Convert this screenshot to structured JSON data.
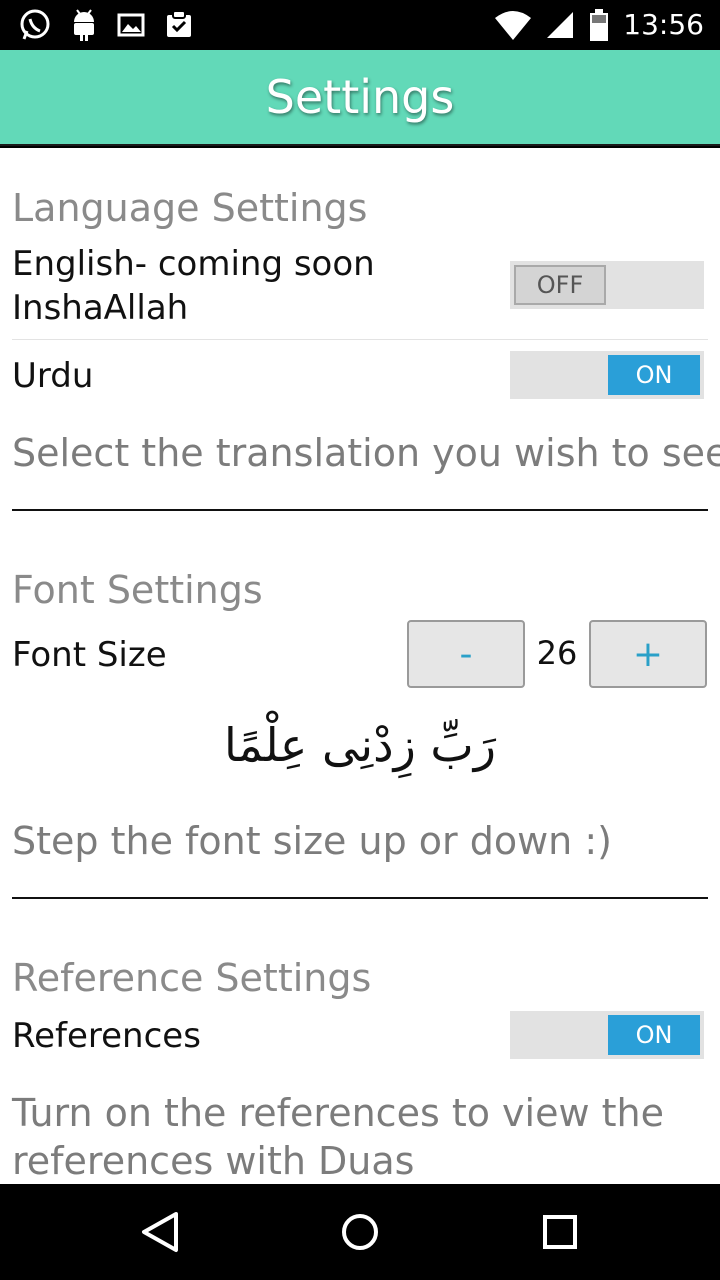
{
  "status_bar": {
    "time": "13:56",
    "left_icons": [
      "whatsapp-icon",
      "android-icon",
      "image-icon",
      "clipboard-icon"
    ],
    "right_icons": [
      "wifi-icon",
      "signal-icon",
      "battery-icon"
    ]
  },
  "app_bar": {
    "title": "Settings",
    "color": "#62d9b8"
  },
  "language": {
    "header": "Language Settings",
    "english_label_line1": "English- coming soon",
    "english_label_line2": "InshaAllah",
    "english_toggle": "OFF",
    "urdu_label": "Urdu",
    "urdu_toggle": "ON",
    "description": "Select the translation you wish to see"
  },
  "font": {
    "header": "Font Settings",
    "label": "Font Size",
    "decrease_label": "-",
    "increase_label": "+",
    "value": "26",
    "sample_text": "رَبِّ زِدْنِى عِلْمًا",
    "description": "Step the font size up or down :)"
  },
  "reference": {
    "header": "Reference Settings",
    "label": "References",
    "toggle": "ON",
    "description_line1": "Turn on the references to view the",
    "description_line2": "references with Duas"
  },
  "colors": {
    "toggle_on": "#2a9fd8",
    "accent": "#62d9b8"
  },
  "nav_bar": {
    "icons": [
      "back-icon",
      "home-icon",
      "recents-icon"
    ]
  }
}
